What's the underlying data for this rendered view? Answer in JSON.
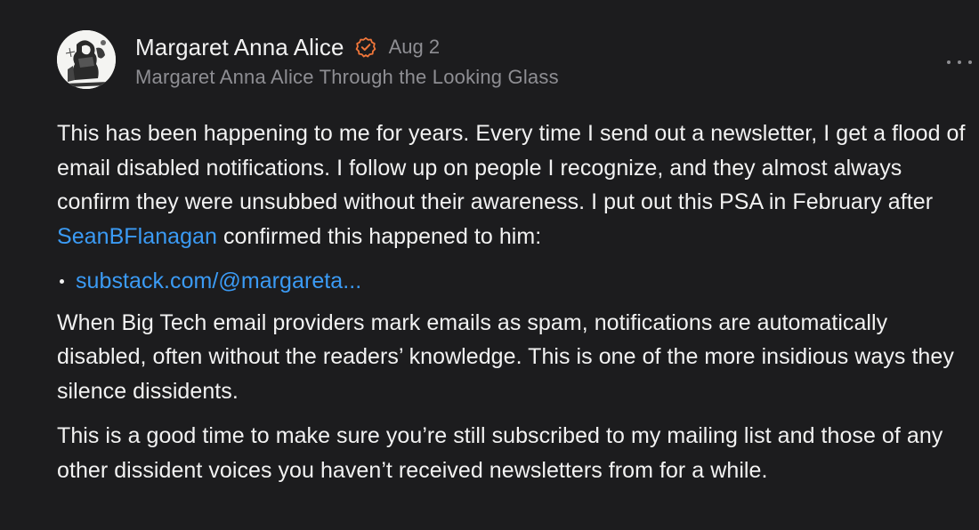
{
  "note": {
    "author": {
      "name": "Margaret Anna Alice",
      "date": "Aug 2",
      "publication": "Margaret Anna Alice Through the Looking Glass",
      "verified_icon": "verified-badge-icon",
      "verified_color": "#f0763a"
    },
    "body": {
      "p1_before": "This has been happening to me for years. Every time I send out a newsletter, I get a flood of email disabled notifications. I follow up on people I recognize, and they almost always confirm they were unsubbed without their awareness. I put out this PSA in February after ",
      "p1_mention": "SeanBFlanagan",
      "p1_after": " confirmed this happened to him:",
      "link": "substack.com/@margareta...",
      "p2": "When Big Tech email providers mark emails as spam, notifications are automatically disabled, often without the readers’ knowledge. This is one of the more insidious ways they silence dissidents.",
      "p3": "This is a good time to make sure you’re still subscribed to my mailing list and those of any other dissident voices you haven’t received newsletters from for a while."
    },
    "colors": {
      "background": "#1c1c1e",
      "link": "#3b9bf5",
      "muted": "#8e8e93"
    }
  }
}
